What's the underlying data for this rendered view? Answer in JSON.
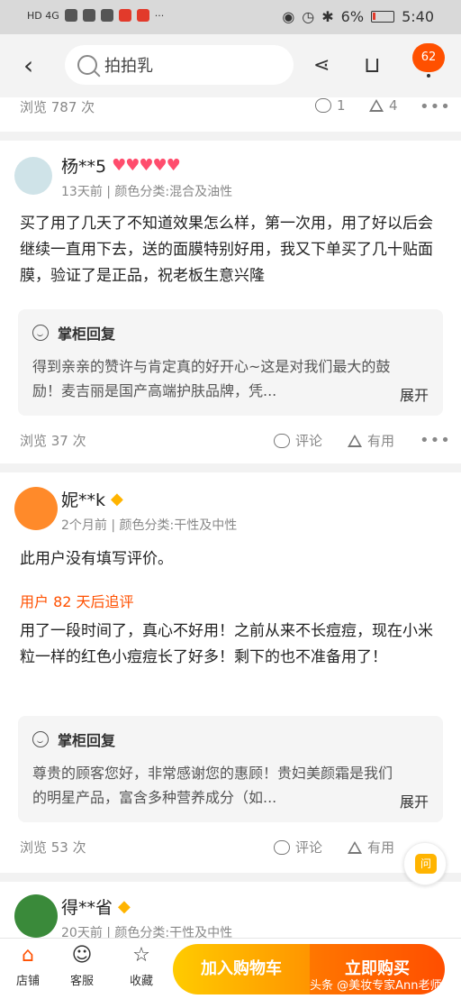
{
  "status_bar": {
    "network": "HD 4G",
    "battery": "6%",
    "time": "5:40"
  },
  "nav": {
    "search_text": "拍拍乳",
    "badge": "62"
  },
  "top_stats": {
    "views": "浏览 787 次",
    "comments": "1",
    "useful": "4"
  },
  "reviews": [
    {
      "name": "杨**5",
      "meta": "13天前 | 颜色分类:混合及油性",
      "text": "买了用了几天了不知道效果怎么样，第一次用，用了好以后会继续一直用下去，送的面膜特别好用，我又下单买了几十贴面膜，验证了是正品，祝老板生意兴隆",
      "reply_title": "掌柜回复",
      "reply_text": "得到亲亲的赞许与肯定真的好开心~这是对我们最大的鼓励！麦吉丽是国产高端护肤品牌，凭...",
      "expand": "展开",
      "views": "浏览 37 次",
      "comment_label": "评论",
      "useful_label": "有用"
    },
    {
      "name": "妮**k",
      "meta": "2个月前 | 颜色分类:干性及中性",
      "text": "此用户没有填写评价。",
      "followup_label": "用户 82 天后追评",
      "followup_text": "用了一段时间了，真心不好用！之前从来不长痘痘，现在小米粒一样的红色小痘痘长了好多！剩下的也不准备用了！",
      "reply_title": "掌柜回复",
      "reply_text": "尊贵的顾客您好，非常感谢您的惠顾！贵妇美颜霜是我们的明星产品，富含多种营养成分（如...",
      "expand": "展开",
      "views": "浏览 53 次",
      "comment_label": "评论",
      "useful_label": "有用"
    },
    {
      "name": "得**省",
      "meta": "20天前 | 颜色分类:干性及中性"
    }
  ],
  "float_button": "问",
  "bottom": {
    "store": "店铺",
    "service": "客服",
    "favorite": "收藏",
    "add_cart": "加入购物车",
    "buy_now": "立即购买",
    "watermark": "头条 @美妆专家Ann老师"
  },
  "colors": {
    "accent": "#ff5000",
    "cart_btn": "#ff9500",
    "buy_btn": "#ff4e00",
    "heart": "#ff4d6d",
    "diamond": "#ffb400"
  }
}
